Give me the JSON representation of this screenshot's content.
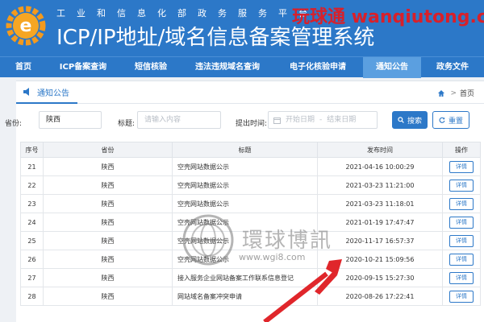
{
  "header": {
    "gov_line": "工业和信息化部政务服务平台",
    "title": "ICP/IP地址/域名信息备案管理系统",
    "watermark": "玩球通 wanqiutong.com",
    "logo_icon": "gear-e-logo-icon",
    "colors": {
      "bar": "#2c78c8",
      "watermark": "#d8202a"
    }
  },
  "nav": {
    "items": [
      {
        "label": "首页"
      },
      {
        "label": "ICP备案查询"
      },
      {
        "label": "短信核验"
      },
      {
        "label": "违法违规域名查询"
      },
      {
        "label": "电子化核验申请"
      },
      {
        "label": "通知公告"
      },
      {
        "label": "政务文件"
      }
    ],
    "active": "通知公告"
  },
  "tab": {
    "label": "通知公告",
    "icon": "speaker-icon"
  },
  "breadcrumb": {
    "home": "首页",
    "sep": ">",
    "icon": "home-icon"
  },
  "filter": {
    "province_label": "省份:",
    "province_value": "陕西",
    "title_label": "标题:",
    "title_placeholder": "请输入内容",
    "time_label": "提出时间:",
    "start_placeholder": "开始日期",
    "range_sep": "-",
    "end_placeholder": "结束日期",
    "search_label": "搜索",
    "reset_label": "重置"
  },
  "table": {
    "headers": [
      "序号",
      "省份",
      "标题",
      "发布时间",
      "操作"
    ],
    "rows": [
      {
        "seq": "21",
        "province": "陕西",
        "title": "空壳网站数据公示",
        "time": "2021-04-16 10:00:29",
        "action": "详情"
      },
      {
        "seq": "22",
        "province": "陕西",
        "title": "空壳网站数据公示",
        "time": "2021-03-23 11:21:00",
        "action": "详情"
      },
      {
        "seq": "23",
        "province": "陕西",
        "title": "空壳网站数据公示",
        "time": "2021-03-23 11:18:01",
        "action": "详情"
      },
      {
        "seq": "24",
        "province": "陕西",
        "title": "空壳网站数据公示",
        "time": "2021-01-19 17:47:47",
        "action": "详情"
      },
      {
        "seq": "25",
        "province": "陕西",
        "title": "空壳网站数据公示",
        "time": "2020-11-17 16:57:37",
        "action": "详情"
      },
      {
        "seq": "26",
        "province": "陕西",
        "title": "空壳网站数据公示",
        "time": "2020-10-21 15:09:56",
        "action": "详情"
      },
      {
        "seq": "27",
        "province": "陕西",
        "title": "接入服务企业网站备案工作联系信息登记",
        "time": "2020-09-15 15:27:30",
        "action": "详情"
      },
      {
        "seq": "28",
        "province": "陕西",
        "title": "网站域名备案冲突申请",
        "time": "2020-08-26 17:22:41",
        "action": "详情"
      }
    ]
  },
  "overlay": {
    "watermark_text": "環球博訊",
    "watermark_url": "www.wgi8.com",
    "arrow_color": "#e0262b"
  }
}
